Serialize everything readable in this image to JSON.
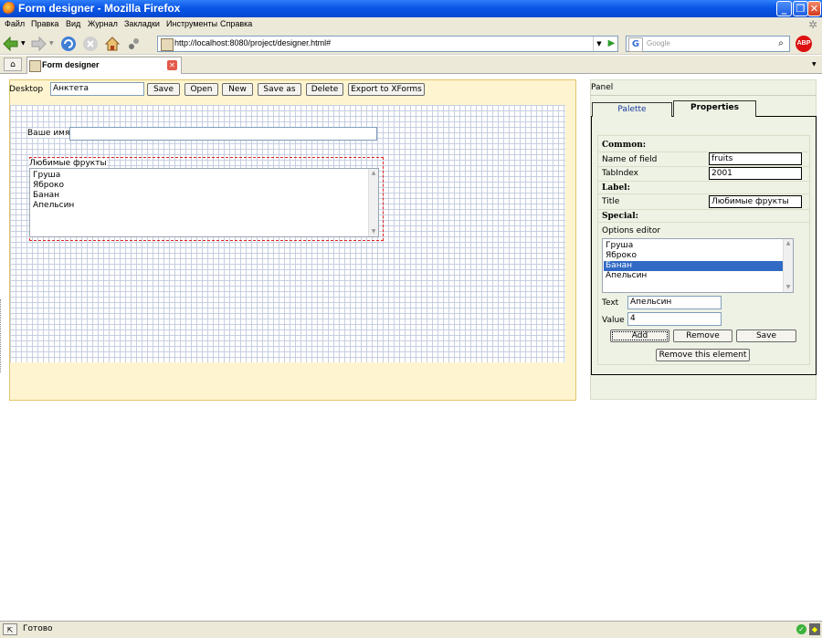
{
  "window": {
    "title": "Form designer - Mozilla Firefox"
  },
  "menu": [
    "Файл",
    "Правка",
    "Вид",
    "Журнал",
    "Закладки",
    "Инструменты",
    "Справка"
  ],
  "nav": {
    "url": "http://localhost:8080/project/designer.html#",
    "search_placeholder": "Google",
    "search_engine_icon": "G",
    "adblock_label": "ABP"
  },
  "tabs": [
    {
      "title": "Form designer"
    }
  ],
  "toolbar": {
    "desktop_label": "Desktop",
    "form_name": "Анктета",
    "buttons": [
      "Save",
      "Open",
      "New",
      "Save as",
      "Delete",
      "Export to XForms"
    ]
  },
  "canvas": {
    "name_field_label": "Ваше имя",
    "list_label": "Любимые фрукты",
    "list_options": [
      "Груша",
      "Яброко",
      "Банан",
      "Апельсин"
    ]
  },
  "panel": {
    "title": "Panel",
    "tabs": {
      "palette": "Palette",
      "properties": "Properties"
    },
    "common_header": "Common:",
    "name_of_field_label": "Name of field",
    "name_of_field_value": "fruits",
    "tabindex_label": "TabIndex",
    "tabindex_value": "2001",
    "label_header": "Label:",
    "title_label": "Title",
    "title_value": "Любимые фрукты",
    "special_header": "Special:",
    "options_editor_label": "Options editor",
    "options": [
      "Груша",
      "Яброко",
      "Банан",
      "Апельсин"
    ],
    "selected_option": "Банан",
    "text_label": "Text",
    "text_value": "Апельсин",
    "value_label": "Value",
    "value_value": "4",
    "buttons": {
      "add": "Add",
      "remove": "Remove",
      "save": "Save",
      "remove_element": "Remove this element"
    }
  },
  "status": {
    "text": "Готово"
  }
}
